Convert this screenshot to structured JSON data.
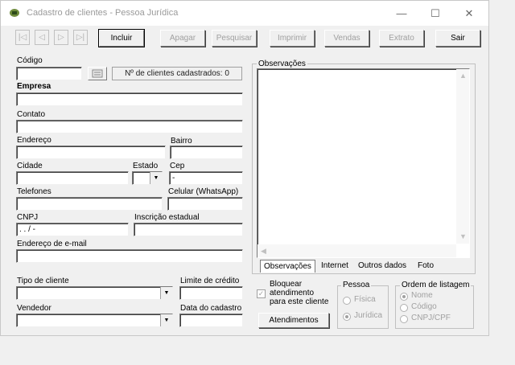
{
  "window": {
    "title": "Cadastro de clientes - Pessoa Jurídica",
    "controls": {
      "minimize": "—",
      "maximize": "☐",
      "close": "✕"
    }
  },
  "toolbar": {
    "nav": [
      "|◁",
      "◁",
      "▷",
      "▷|"
    ],
    "incluir": "Incluir",
    "apagar": "Apagar",
    "pesquisar": "Pesquisar",
    "imprimir": "Imprimir",
    "vendas": "Vendas",
    "extrato": "Extrato",
    "sair": "Sair"
  },
  "form": {
    "codigo_label": "Código",
    "codigo_value": "",
    "counter_text": "Nº de clientes cadastrados: 0",
    "empresa_label": "Empresa",
    "contato_label": "Contato",
    "endereco_label": "Endereço",
    "bairro_label": "Bairro",
    "cidade_label": "Cidade",
    "estado_label": "Estado",
    "cep_label": "Cep",
    "cep_value": "     -",
    "telefones_label": "Telefones",
    "celular_label": "Celular (WhatsApp)",
    "cnpj_label": "CNPJ",
    "cnpj_value": "  .   .   /    -",
    "ie_label": "Inscrição estadual",
    "email_label": "Endereço de e-mail",
    "tipo_label": "Tipo de cliente",
    "limite_label": "Limite de crédito",
    "vendedor_label": "Vendedor",
    "data_label": "Data do cadastro"
  },
  "observacoes": {
    "title": "Observações",
    "tabs": [
      "Observações",
      "Internet",
      "Outros dados",
      "Foto"
    ]
  },
  "bloquear": {
    "label_line1": "Bloquear",
    "label_line2": "atendimento",
    "label_line3": "para este cliente",
    "checked": "✓"
  },
  "atendimentos_button": "Atendimentos",
  "pessoa": {
    "title": "Pessoa",
    "options": [
      "Física",
      "Jurídica"
    ]
  },
  "ordem": {
    "title": "Ordem de listagem",
    "options": [
      "Nome",
      "Código",
      "CNPJ/CPF"
    ]
  }
}
